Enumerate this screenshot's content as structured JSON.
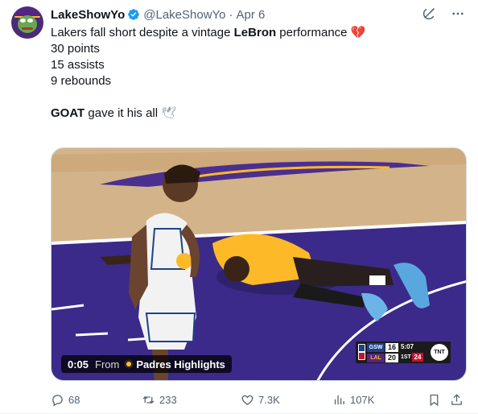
{
  "author": {
    "display_name": "LakeShowYo",
    "verified": true,
    "handle": "@LakeShowYo",
    "separator": "·",
    "date": "Apr 6"
  },
  "tweet": {
    "line1_pre": "Lakers fall short despite a vintage ",
    "line1_bold": "LeBron",
    "line1_post": " performance ",
    "line1_emoji": "💔",
    "stat1": "30 points",
    "stat2": "15 assists",
    "stat3": "9 rebounds",
    "line5_bold": "GOAT",
    "line5_post": " gave it his all ",
    "line5_emoji": "🕊"
  },
  "video": {
    "time": "0:05",
    "from_label": "From",
    "source": "Padres Highlights",
    "scorebug": {
      "team1": "GSW",
      "score1": "16",
      "team2": "LAL",
      "score2": "20",
      "clock": "5:07",
      "quarter": "1ST",
      "shot_clock": "24",
      "network": "TNT"
    }
  },
  "metrics": {
    "replies": "68",
    "retweets": "233",
    "likes": "7.3K",
    "views": "107K"
  },
  "colors": {
    "text": "#0f1419",
    "secondary": "#536471",
    "verified": "#1d9bf0",
    "court_purple": "#3b2a8a",
    "lakers_gold": "#fdb927"
  },
  "icons": {
    "header": [
      "grok-icon",
      "more-icon"
    ],
    "actions": [
      "reply-icon",
      "retweet-icon",
      "like-icon",
      "views-icon",
      "bookmark-icon",
      "share-icon"
    ]
  }
}
